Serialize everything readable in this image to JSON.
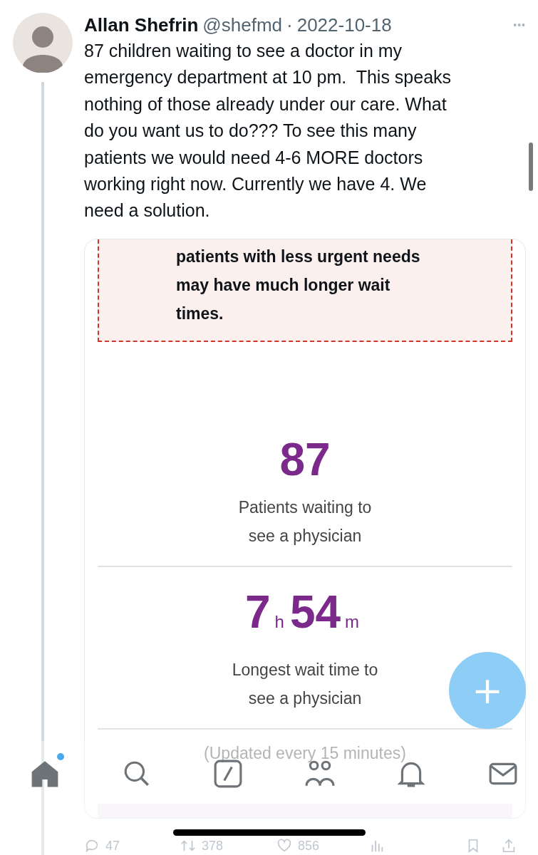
{
  "post": {
    "author": "Allan Shefrin",
    "handle": "@shefmd",
    "separator": "·",
    "date": "2022-10-18",
    "more": "•••",
    "text": "87 children waiting to see a doctor in my\nemergency department at 10 pm.  This speaks\nnothing of those already under our care. What\ndo you want us to do??? To see this many\npatients we would need 4-6 MORE doctors\nworking right now. Currently we have 4. We\nneed a solution."
  },
  "card": {
    "notice": "patients with less urgent needs\nmay have much longer wait\ntimes.",
    "stats": [
      {
        "kind": "count",
        "value": "87",
        "label": "Patients waiting to\nsee a physician"
      },
      {
        "kind": "duration",
        "hours": "7",
        "hours_unit": "h",
        "minutes": "54",
        "minutes_unit": "m",
        "label": "Longest wait time to\nsee a physician"
      }
    ],
    "footer": "(Updated every 15 minutes)"
  },
  "actions": [
    {
      "kind": "reply",
      "count": "47"
    },
    {
      "kind": "repost",
      "count": "378"
    },
    {
      "kind": "like",
      "count": "856"
    },
    {
      "kind": "views"
    },
    {
      "kind": "bookmark"
    },
    {
      "kind": "share"
    }
  ],
  "compose_button": "+",
  "nav": [
    {
      "kind": "home",
      "selected": true,
      "badge": true
    },
    {
      "kind": "search",
      "selected": false
    },
    {
      "kind": "compose",
      "selected": false
    },
    {
      "kind": "communities",
      "selected": false
    },
    {
      "kind": "notifications",
      "selected": false
    },
    {
      "kind": "messages",
      "selected": false
    }
  ]
}
